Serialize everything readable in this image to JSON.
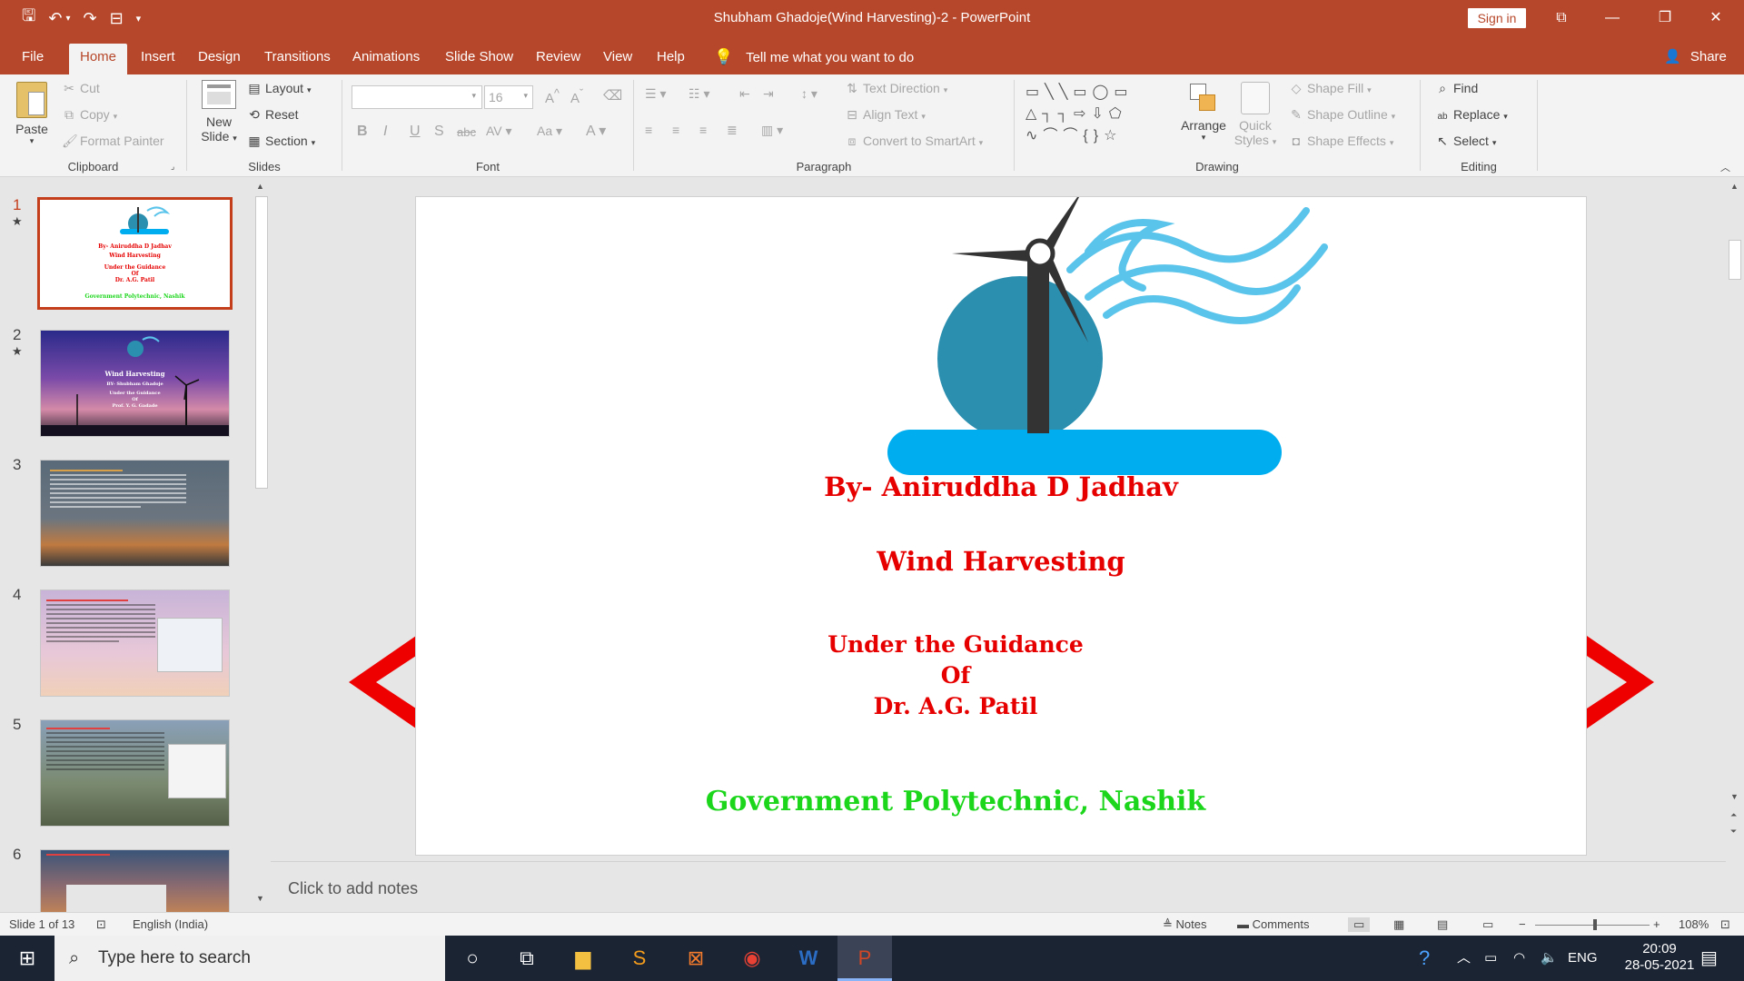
{
  "window": {
    "title": "Shubham Ghadoje(Wind Harvesting)-2  -  PowerPoint",
    "sign_in": "Sign in"
  },
  "tabs": [
    "File",
    "Home",
    "Insert",
    "Design",
    "Transitions",
    "Animations",
    "Slide Show",
    "Review",
    "View",
    "Help"
  ],
  "tell_me": "Tell me what you want to do",
  "share": "Share",
  "ribbon": {
    "clipboard": {
      "label": "Clipboard",
      "paste": "Paste",
      "cut": "Cut",
      "copy": "Copy",
      "format_painter": "Format Painter"
    },
    "slides": {
      "label": "Slides",
      "new_slide_1": "New",
      "new_slide_2": "Slide",
      "layout": "Layout",
      "reset": "Reset",
      "section": "Section"
    },
    "font": {
      "label": "Font",
      "size": "16"
    },
    "paragraph": {
      "label": "Paragraph",
      "text_direction": "Text Direction",
      "align_text": "Align Text",
      "convert_smartart": "Convert to SmartArt"
    },
    "drawing": {
      "label": "Drawing",
      "arrange": "Arrange",
      "quick_styles_1": "Quick",
      "quick_styles_2": "Styles",
      "shape_fill": "Shape Fill",
      "shape_outline": "Shape Outline",
      "shape_effects": "Shape Effects"
    },
    "editing": {
      "label": "Editing",
      "find": "Find",
      "replace": "Replace",
      "select": "Select"
    }
  },
  "thumbnails": [
    {
      "num": "1",
      "star": "★",
      "title": "Wind Harvesting",
      "lines": [
        "By- Aniruddha D Jadhav",
        "Wind Harvesting",
        "Under the Guidance",
        "Of",
        "Dr. A.G. Patil",
        "Government Polytechnic, Nashik"
      ]
    },
    {
      "num": "2",
      "star": "★",
      "title": "Wind Harvesting",
      "lines": [
        "BY- Shubham Ghadoje",
        "Under the Guidance",
        "Of",
        "Prof. Y. G. Gadade"
      ]
    },
    {
      "num": "3",
      "star": "",
      "title": "",
      "lines": []
    },
    {
      "num": "4",
      "star": "",
      "title": "",
      "lines": []
    },
    {
      "num": "5",
      "star": "",
      "title": "",
      "lines": []
    },
    {
      "num": "6",
      "star": "",
      "title": "",
      "lines": []
    }
  ],
  "slide": {
    "author": "By- Aniruddha D Jadhav",
    "title": "Wind Harvesting",
    "guidance": "Under the Guidance",
    "of": "Of",
    "guide": "Dr. A.G. Patil",
    "institute": "Government Polytechnic, Nashik",
    "colors": {
      "red": "#e60000",
      "green": "#1bd61b",
      "turbine_blue": "#2b8fb0",
      "wave_blue": "#5bc4ea",
      "base_blue": "#00aeef"
    }
  },
  "notes_placeholder": "Click to add notes",
  "status": {
    "slide_of": "Slide 1 of 13",
    "language": "English (India)",
    "notes": "Notes",
    "comments": "Comments",
    "zoom": "108%"
  },
  "taskbar": {
    "search_placeholder": "Type here to search",
    "lang": "ENG",
    "time": "20:09",
    "date": "28-05-2021"
  }
}
